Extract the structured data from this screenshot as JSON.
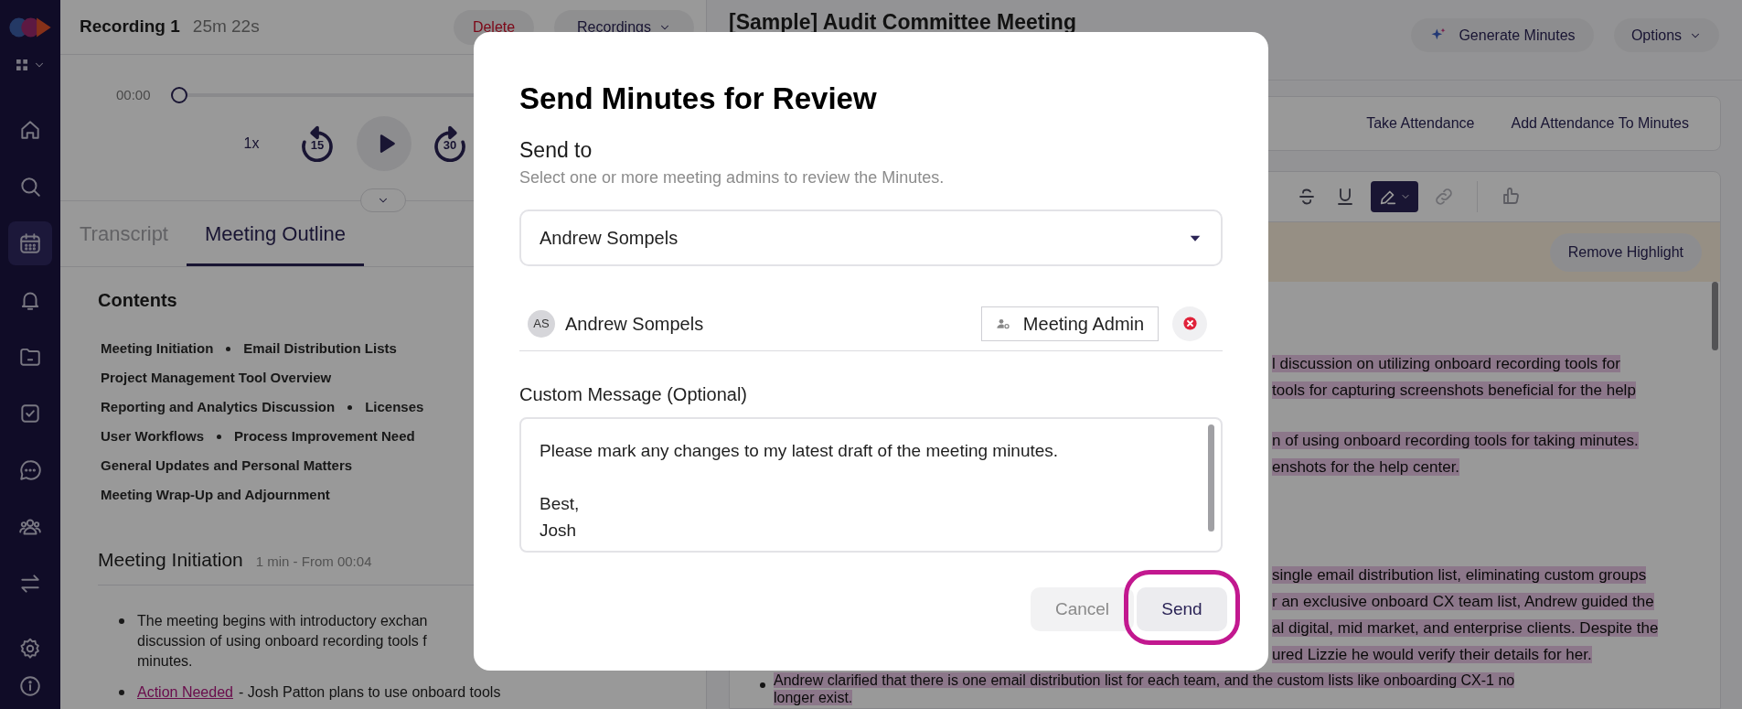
{
  "sidebar": {
    "items": [
      {
        "kind": "home",
        "selected": false
      },
      {
        "kind": "search",
        "selected": false
      },
      {
        "kind": "calendar",
        "selected": true
      },
      {
        "kind": "bell",
        "selected": false
      },
      {
        "kind": "folder",
        "selected": false
      },
      {
        "kind": "tasks",
        "selected": false
      },
      {
        "kind": "chat",
        "selected": false
      },
      {
        "kind": "people",
        "selected": false
      },
      {
        "kind": "transfer",
        "selected": false
      }
    ],
    "footer_items": [
      {
        "kind": "settings",
        "selected": false
      },
      {
        "kind": "info",
        "selected": false
      }
    ]
  },
  "recording": {
    "title": "Recording 1",
    "duration": "25m 22s",
    "delete_label": "Delete",
    "menu_label": "Recordings"
  },
  "player": {
    "time": "00:00",
    "level": 0,
    "speed": "1x",
    "rewind_seconds": "15",
    "forward_seconds": "30"
  },
  "outline_tabs": [
    {
      "label": "Transcript",
      "selected": false
    },
    {
      "label": "Meeting Outline",
      "selected": true
    }
  ],
  "contents": {
    "heading": "Contents",
    "rows": [
      [
        "Meeting Initiation",
        "Email Distribution Lists"
      ],
      [
        "Project Management Tool Overview"
      ],
      [
        "Reporting and Analytics Discussion",
        "Licenses"
      ],
      [
        "User Workflows",
        "Process Improvement Need"
      ],
      [
        "General Updates and Personal Matters"
      ],
      [
        "Meeting Wrap-Up and Adjournment"
      ]
    ]
  },
  "section": {
    "title": "Meeting Initiation",
    "meta": "1 min - From 00:04",
    "bullets": [
      {
        "kind": "text",
        "lines": [
          "The meeting begins with introductory exchan",
          "discussion of using onboard recording tools f",
          "minutes."
        ]
      },
      {
        "kind": "action",
        "tag": "Action Needed",
        "lines": [
          "- Josh Patton plans to use onboard tools"
        ]
      }
    ]
  },
  "meeting": {
    "title": "[Sample] Audit Committee Meeting",
    "generate_label": "Generate Minutes",
    "options_label": "Options"
  },
  "attendance": {
    "take_label": "Take Attendance",
    "add_label": "Add Attendance To Minutes"
  },
  "editor_toolbar": [
    {
      "kind": "strike",
      "selected": false
    },
    {
      "kind": "underline",
      "selected": false
    },
    {
      "kind": "highlight",
      "selected": true
    },
    {
      "kind": "link",
      "selected": false
    },
    {
      "kind": "feedback",
      "selected": false
    }
  ],
  "highlight_banner": {
    "button_label": "Remove Highlight"
  },
  "minutes_blocks": [
    {
      "kind": "paragraph",
      "lines": [
        "l discussion on utilizing onboard recording tools for",
        "tools for capturing screenshots beneficial for the help"
      ]
    },
    {
      "kind": "paragraph",
      "lines": [
        "n of using onboard recording tools for taking minutes.",
        "enshots for the help center."
      ]
    },
    {
      "kind": "paragraph",
      "lines": [
        "single email distribution list, eliminating custom groups",
        "r an exclusive onboard CX team list, Andrew guided the",
        "al digital, mid market, and enterprise clients. Despite the",
        "ured Lizzie he would verify their details for her."
      ]
    },
    {
      "kind": "bullet",
      "lines": [
        "Andrew clarified that there is one email distribution list for each team, and the custom lists like onboarding CX-1 no",
        "longer exist."
      ]
    }
  ],
  "modal": {
    "title": "Send Minutes for Review",
    "send_to_label": "Send to",
    "send_to_hint": "Select one or more meeting admins to review the Minutes.",
    "select_value": "Andrew Sompels",
    "recipients": [
      {
        "initials": "AS",
        "name": "Andrew Sompels",
        "role": "Meeting Admin"
      }
    ],
    "message_label": "Custom Message (Optional)",
    "message": "Please mark any changes to my latest draft of the meeting minutes.\n\nBest,\nJosh",
    "cancel_label": "Cancel",
    "send_button": {
      "label": "Send",
      "circled": true
    }
  }
}
